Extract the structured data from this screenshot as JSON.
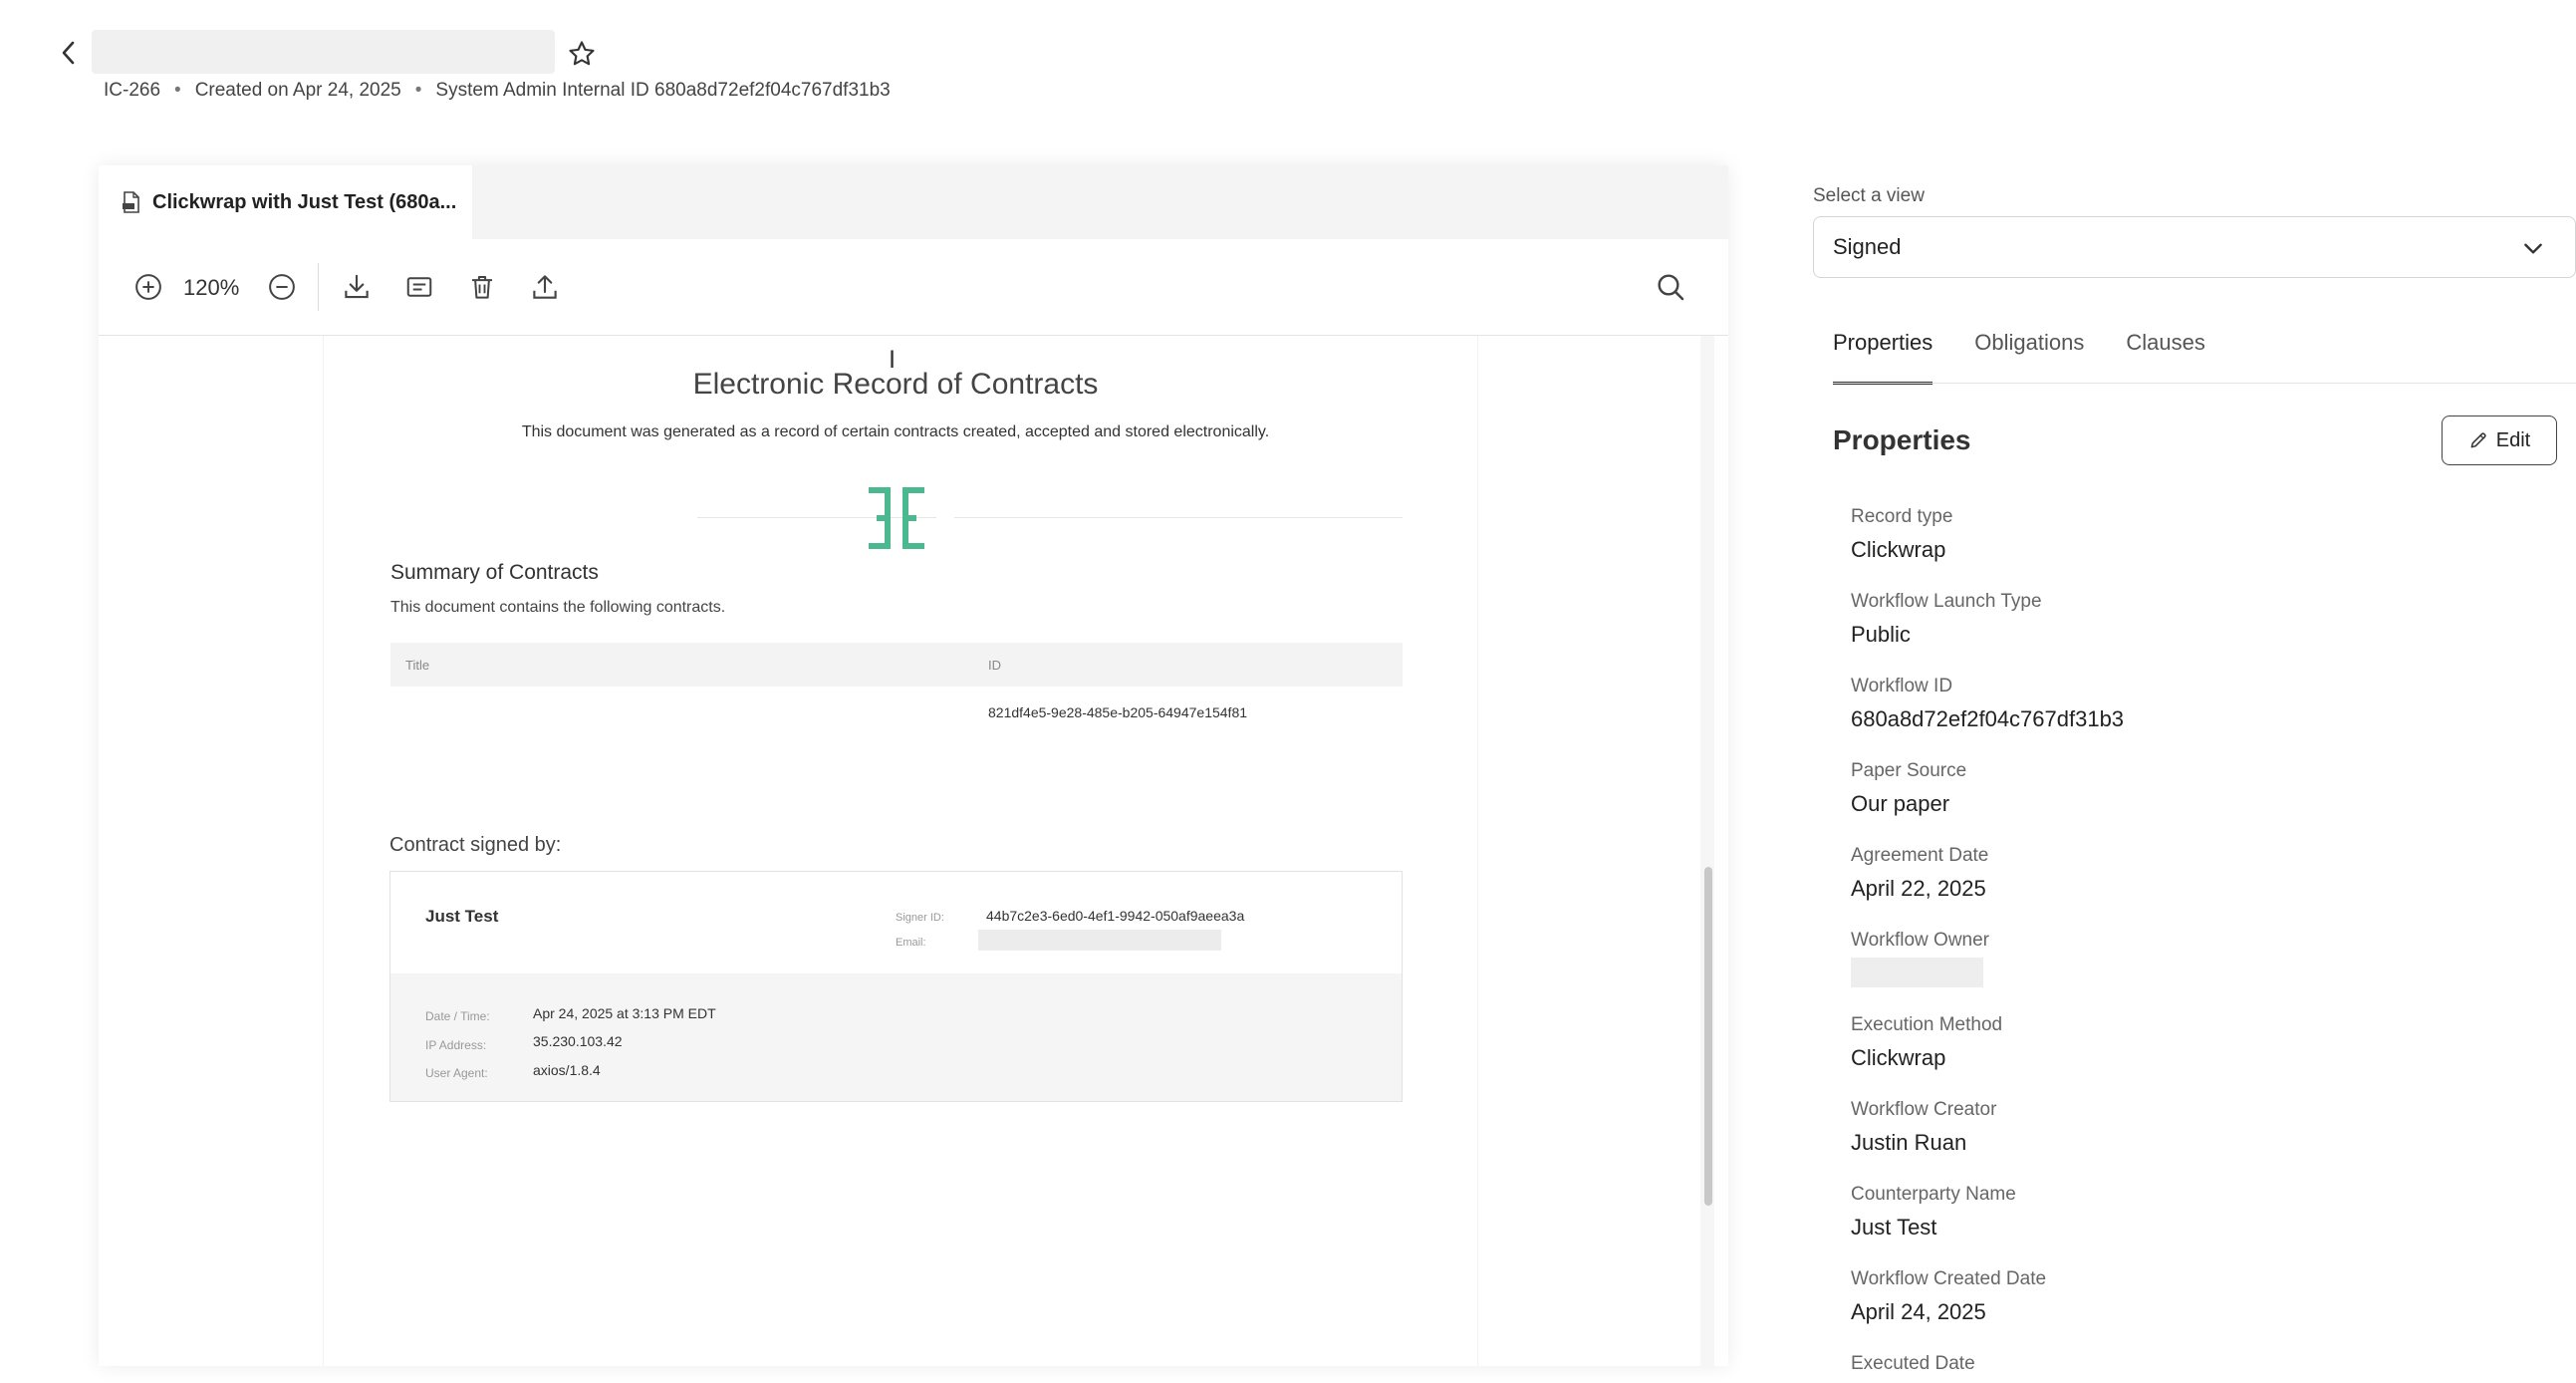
{
  "header": {
    "back_icon": "chevron-left-icon",
    "star_icon": "star-outline-icon",
    "record_code": "IC-266",
    "created": "Created on Apr 24, 2025",
    "internal_id": "System Admin Internal ID 680a8d72ef2f04c767df31b3"
  },
  "viewer": {
    "tab_label": "Clickwrap with Just Test (680a...",
    "toolbar": {
      "zoom": "120%",
      "icons": [
        "zoom-in-icon",
        "zoom-out-icon",
        "download-icon",
        "comment-icon",
        "trash-icon",
        "share-upload-icon",
        "search-icon"
      ]
    },
    "document": {
      "title": "Electronic Record of Contracts",
      "subtitle": "This document was generated as a record of certain contracts created, accepted and stored electronically.",
      "summary_title": "Summary of Contracts",
      "summary_sub": "This document contains the following contracts.",
      "table_headers": [
        "Title",
        "ID"
      ],
      "table_rows": [
        {
          "title": "",
          "id": "821df4e5-9e28-485e-b205-64947e154f81"
        }
      ],
      "signed_by_label": "Contract signed by:",
      "signer": {
        "name": "Just Test",
        "signer_id_label": "Signer ID:",
        "signer_id": "44b7c2e3-6ed0-4ef1-9942-050af9aeea3a",
        "email_label": "Email:",
        "date_label": "Date / Time:",
        "date": "Apr 24, 2025 at 3:13 PM EDT",
        "ip_label": "IP Address:",
        "ip": "35.230.103.42",
        "ua_label": "User Agent:",
        "ua": "axios/1.8.4"
      },
      "logo_color": "#4cb88f"
    }
  },
  "panel": {
    "select_label": "Select a view",
    "select_value": "Signed",
    "tabs": [
      {
        "label": "Properties",
        "active": true
      },
      {
        "label": "Obligations",
        "active": false
      },
      {
        "label": "Clauses",
        "active": false
      }
    ],
    "section_title": "Properties",
    "edit_label": "Edit",
    "properties": [
      {
        "label": "Record type",
        "value": "Clickwrap"
      },
      {
        "label": "Workflow Launch Type",
        "value": "Public"
      },
      {
        "label": "Workflow ID",
        "value": "680a8d72ef2f04c767df31b3"
      },
      {
        "label": "Paper Source",
        "value": "Our paper"
      },
      {
        "label": "Agreement Date",
        "value": "April 22, 2025"
      },
      {
        "label": "Workflow Owner",
        "value": ""
      },
      {
        "label": "Execution Method",
        "value": "Clickwrap"
      },
      {
        "label": "Workflow Creator",
        "value": "Justin Ruan"
      },
      {
        "label": "Counterparty Name",
        "value": "Just Test"
      },
      {
        "label": "Workflow Created Date",
        "value": "April 24, 2025"
      },
      {
        "label": "Executed Date",
        "value": ""
      }
    ]
  }
}
